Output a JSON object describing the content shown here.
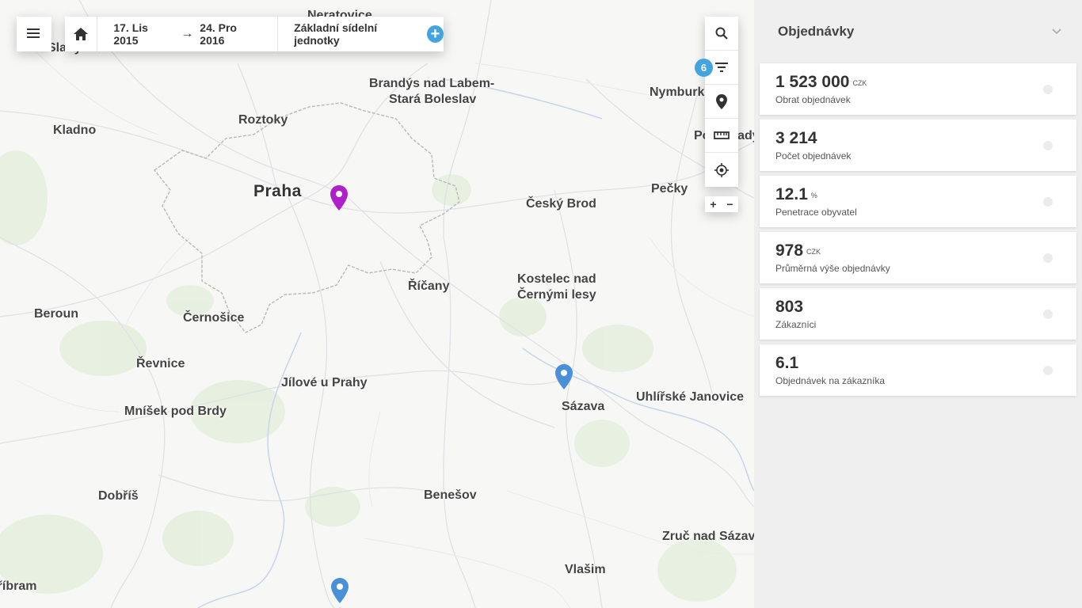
{
  "toolbar": {
    "menu_icon": "menu-icon",
    "home_icon": "home-icon",
    "date_from": "17. Lis 2015",
    "date_arrow": "→",
    "date_to": "24. Pro 2016",
    "unit_label": "Základní sídelní jednotky",
    "add_symbol": "+"
  },
  "map_tools": {
    "filter_count": "6",
    "zoom_in": "+",
    "zoom_out": "−",
    "icons": [
      "search-icon",
      "filter-icon",
      "location-pin-icon",
      "ruler-icon",
      "locate-icon"
    ]
  },
  "map": {
    "labels": [
      "Slaný",
      "Neratovice",
      "Brandýs nad Labem-",
      "Stará Boleslav",
      "Nymburk",
      "Kladno",
      "Roztoky",
      "Poděbrady",
      "Praha",
      "Český Brod",
      "Pečky",
      "Kostelec nad",
      "Černými lesy",
      "Říčany",
      "Beroun",
      "Černošice",
      "Řevnice",
      "Jílové u Prahy",
      "Sázava",
      "Uhlířské Janovice",
      "Mníšek pod Brdy",
      "Dobříš",
      "Benešov",
      "Zruč nad Sázavou",
      "Vlašim",
      "Příbram"
    ],
    "marker_colors": {
      "selected": "#b020c8",
      "default": "#4a90d9"
    }
  },
  "panel": {
    "title": "Objednávky",
    "cards": [
      {
        "value": "1 523 000",
        "unit": "CZK",
        "label": "Obrat objednávek"
      },
      {
        "value": "3 214",
        "unit": "",
        "label": "Počet objednávek"
      },
      {
        "value": "12.1",
        "unit": "%",
        "label": "Penetrace obyvatel"
      },
      {
        "value": "978",
        "unit": "CZK",
        "label": "Průměrná výše objednávky"
      },
      {
        "value": "803",
        "unit": "",
        "label": "Zákazníci"
      },
      {
        "value": "6.1",
        "unit": "",
        "label": "Objednávek na zákazníka"
      }
    ]
  },
  "colors": {
    "accent": "#42a5e0"
  }
}
